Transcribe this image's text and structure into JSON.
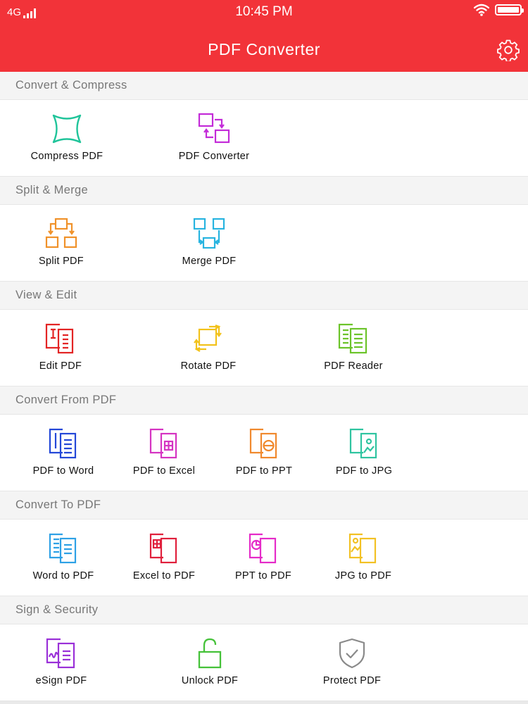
{
  "status": {
    "carrier": "4G",
    "time": "10:45 PM"
  },
  "nav": {
    "title": "PDF Converter",
    "settings_icon": "gear-icon"
  },
  "colors": {
    "brand": "#f23339",
    "teal": "#20c49a",
    "purple": "#c32bd8",
    "orange": "#f0922a",
    "cyan": "#28b4e0",
    "red": "#e32424",
    "yellow": "#f2c21b",
    "green": "#6cc42a",
    "blue": "#2448d8",
    "magenta": "#d534c2",
    "orange2": "#f0892e",
    "mint": "#2fc4a0",
    "sky": "#2ea1e6",
    "crimson": "#e0203c",
    "pink": "#e52bc8",
    "gold": "#f2c124",
    "violet": "#9a30d8",
    "lime": "#46c23a",
    "gray": "#8a8a8a"
  },
  "sections": [
    {
      "title": "Convert & Compress",
      "tools": [
        {
          "label": "Compress PDF",
          "icon": "compress-icon"
        },
        {
          "label": "PDF Converter",
          "icon": "convert-icon"
        }
      ]
    },
    {
      "title": "Split & Merge",
      "tools": [
        {
          "label": "Split PDF",
          "icon": "split-icon"
        },
        {
          "label": "Merge PDF",
          "icon": "merge-icon"
        }
      ]
    },
    {
      "title": "View & Edit",
      "tools": [
        {
          "label": "Edit PDF",
          "icon": "edit-icon"
        },
        {
          "label": "Rotate PDF",
          "icon": "rotate-icon"
        },
        {
          "label": "PDF Reader",
          "icon": "reader-icon"
        }
      ]
    },
    {
      "title": "Convert From PDF",
      "tools": [
        {
          "label": "PDF to Word",
          "icon": "word-doc-icon"
        },
        {
          "label": "PDF to Excel",
          "icon": "excel-doc-icon"
        },
        {
          "label": "PDF to PPT",
          "icon": "ppt-doc-icon"
        },
        {
          "label": "PDF to JPG",
          "icon": "jpg-doc-icon"
        }
      ]
    },
    {
      "title": "Convert To PDF",
      "tools": [
        {
          "label": "Word to PDF",
          "icon": "word-doc-icon"
        },
        {
          "label": "Excel to PDF",
          "icon": "excel-doc-icon"
        },
        {
          "label": "PPT to PDF",
          "icon": "ppt-doc-icon"
        },
        {
          "label": "JPG to PDF",
          "icon": "jpg-doc-icon"
        }
      ]
    },
    {
      "title": "Sign & Security",
      "tools": [
        {
          "label": "eSign PDF",
          "icon": "signature-icon"
        },
        {
          "label": "Unlock PDF",
          "icon": "unlock-icon"
        },
        {
          "label": "Protect PDF",
          "icon": "shield-check-icon"
        }
      ]
    }
  ]
}
